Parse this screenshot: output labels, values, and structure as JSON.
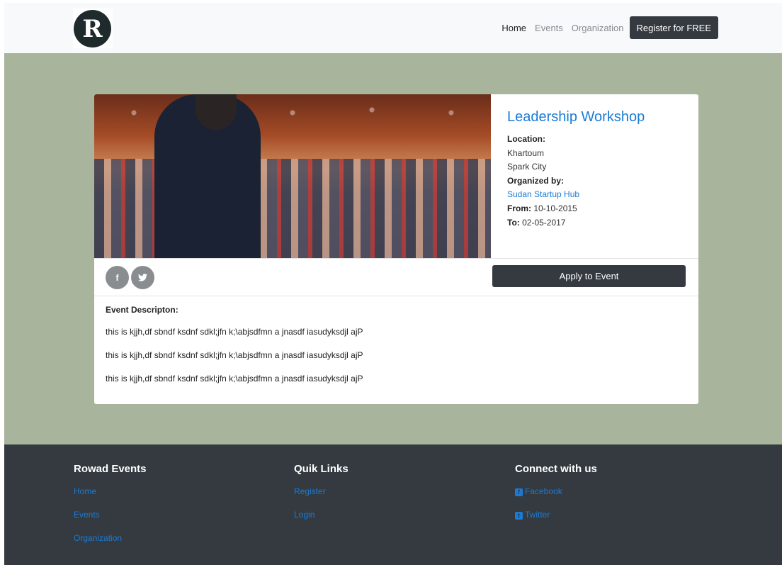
{
  "navbar": {
    "logo_letter": "R",
    "links": [
      "Home",
      "Events",
      "Organization"
    ],
    "cta": "Register for FREE"
  },
  "event": {
    "title": "Leadership Workshop",
    "location_label": "Location:",
    "location_city": "Khartoum",
    "location_place": "Spark City",
    "organized_label": "Organized by:",
    "organizer": "Sudan Startup Hub",
    "from_label": "From:",
    "from_date": "10-10-2015",
    "to_label": "To:",
    "to_date": "02-05-2017",
    "apply_label": "Apply to Event",
    "social": [
      "f",
      "t"
    ],
    "description_title": "Event Descripton:",
    "description": [
      "this is kjjh,df sbndf ksdnf sdkl;jfn k;\\abjsdfmn a jnasdf iasudyksdjl ajP",
      "this is kjjh,df sbndf ksdnf sdkl;jfn k;\\abjsdfmn a jnasdf iasudyksdjl ajP",
      "this is kjjh,df sbndf ksdnf sdkl;jfn k;\\abjsdfmn a jnasdf iasudyksdjl ajP"
    ]
  },
  "footer": {
    "col1": {
      "title": "Rowad Events",
      "links": [
        "Home",
        "Events",
        "Organization"
      ]
    },
    "col2": {
      "title": "Quik Links",
      "links": [
        "Register",
        "Login"
      ]
    },
    "col3": {
      "title": "Connect with us",
      "links": [
        "Facebook",
        "Twitter"
      ]
    }
  },
  "colors": {
    "main_bg": "#a8b59c",
    "dark": "#343a40",
    "link": "#1a7bd6"
  }
}
